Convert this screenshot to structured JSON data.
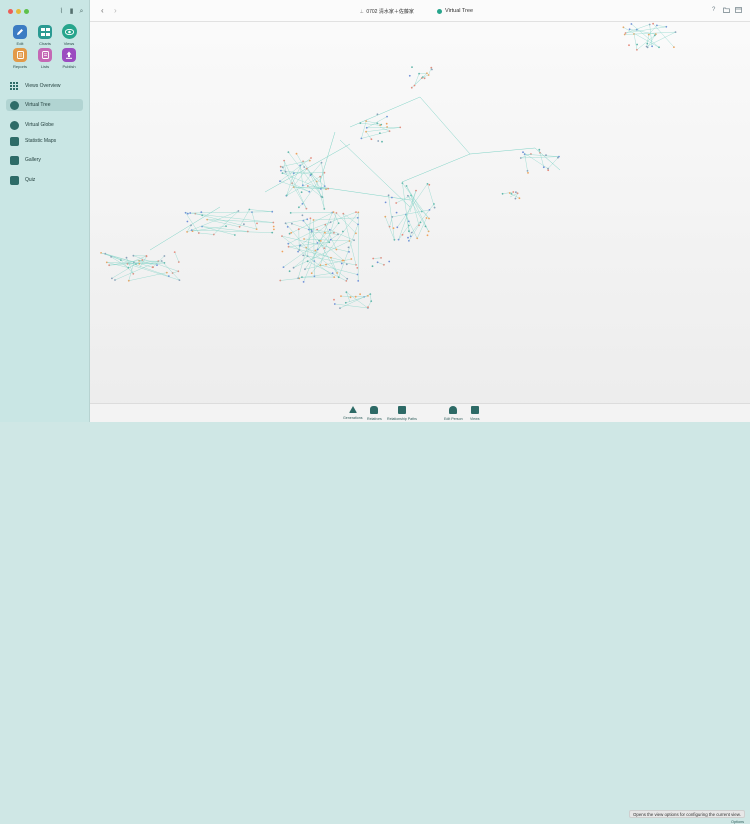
{
  "sidebar": {
    "toolbar_icons": [
      "paperclip-icon",
      "bookmark-icon",
      "search-people-icon"
    ],
    "modules": [
      {
        "label": "Edit",
        "icon": "pencil-icon"
      },
      {
        "label": "Charts",
        "icon": "charts-icon"
      },
      {
        "label": "Views",
        "icon": "eye-icon"
      },
      {
        "label": "Reports",
        "icon": "reports-icon"
      },
      {
        "label": "Lists",
        "icon": "lists-icon"
      },
      {
        "label": "Publish",
        "icon": "publish-icon"
      }
    ],
    "nav": [
      {
        "label": "Views Overview",
        "icon": "grid-icon"
      },
      {
        "label": "Virtual Tree",
        "icon": "virtual-tree-icon",
        "active": true
      },
      {
        "label": "Virtual Globe",
        "icon": "globe-icon"
      },
      {
        "label": "Statistic Maps",
        "icon": "statistic-maps-icon"
      },
      {
        "label": "Gallery",
        "icon": "gallery-icon"
      },
      {
        "label": "Quiz",
        "icon": "quiz-icon"
      }
    ]
  },
  "titlebar": {
    "back": "‹",
    "forward": "›",
    "document_title": "0702 清水家＋佐藤家",
    "view_title": "Virtual Tree",
    "right_icons": [
      "help-icon",
      "folder-icon",
      "window-icon"
    ],
    "help": "?"
  },
  "bottombar": {
    "items": [
      "Generations",
      "Relatives",
      "Relationship Paths",
      "Edit Person",
      "Views"
    ],
    "tooltip": "Opens the view options for configuring the current view.",
    "options": "Options"
  },
  "colors": {
    "accent": "#27a58c",
    "sidebar": "#c9e6e4",
    "link": "#7fd3c6"
  }
}
